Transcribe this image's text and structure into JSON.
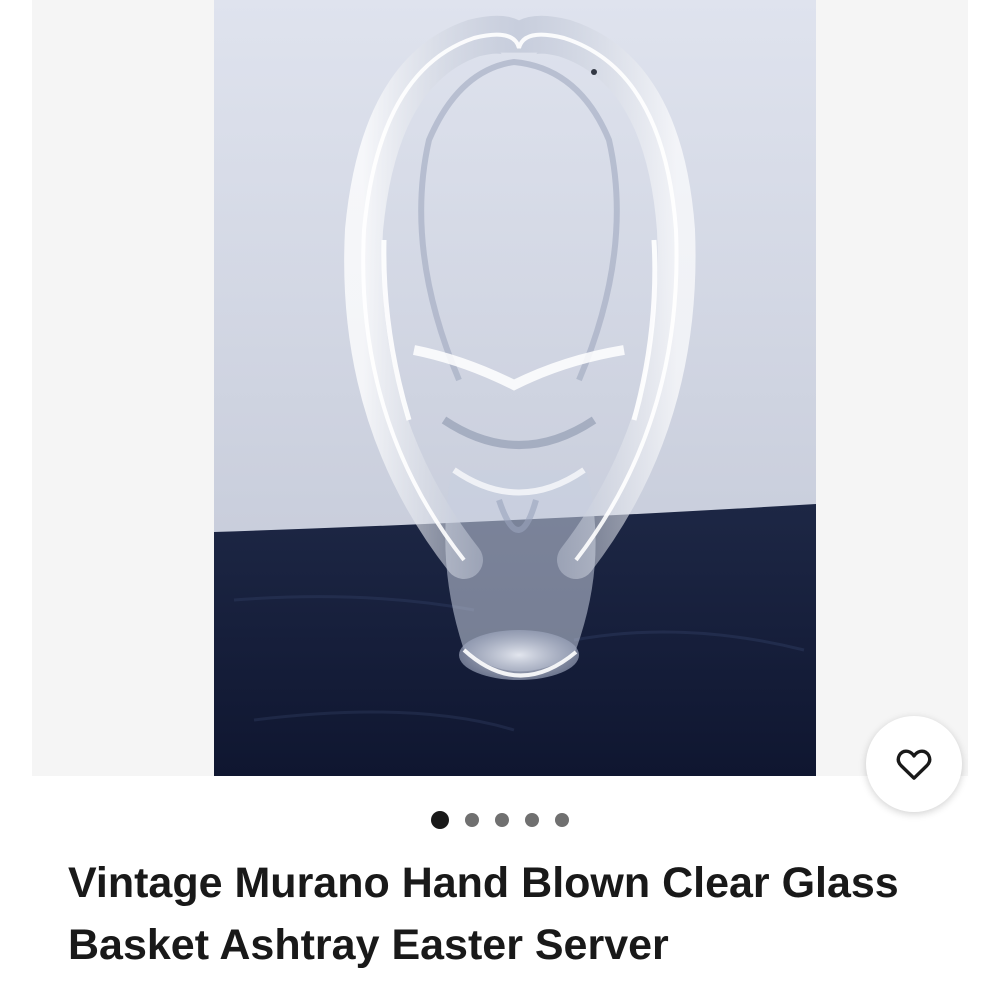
{
  "listing": {
    "title": "Vintage Murano Hand Blown Clear Glass Basket Ashtray Easter Server",
    "image_alt": "Clear hand blown glass basket on dark cloth"
  },
  "gallery": {
    "image_count": 5,
    "active_index": 0
  },
  "actions": {
    "watch_icon": "heart-icon"
  },
  "colors": {
    "title_text": "#191919",
    "active_dot": "#191919",
    "inactive_dot": "#707070",
    "gallery_bg": "#f5f5f5"
  }
}
